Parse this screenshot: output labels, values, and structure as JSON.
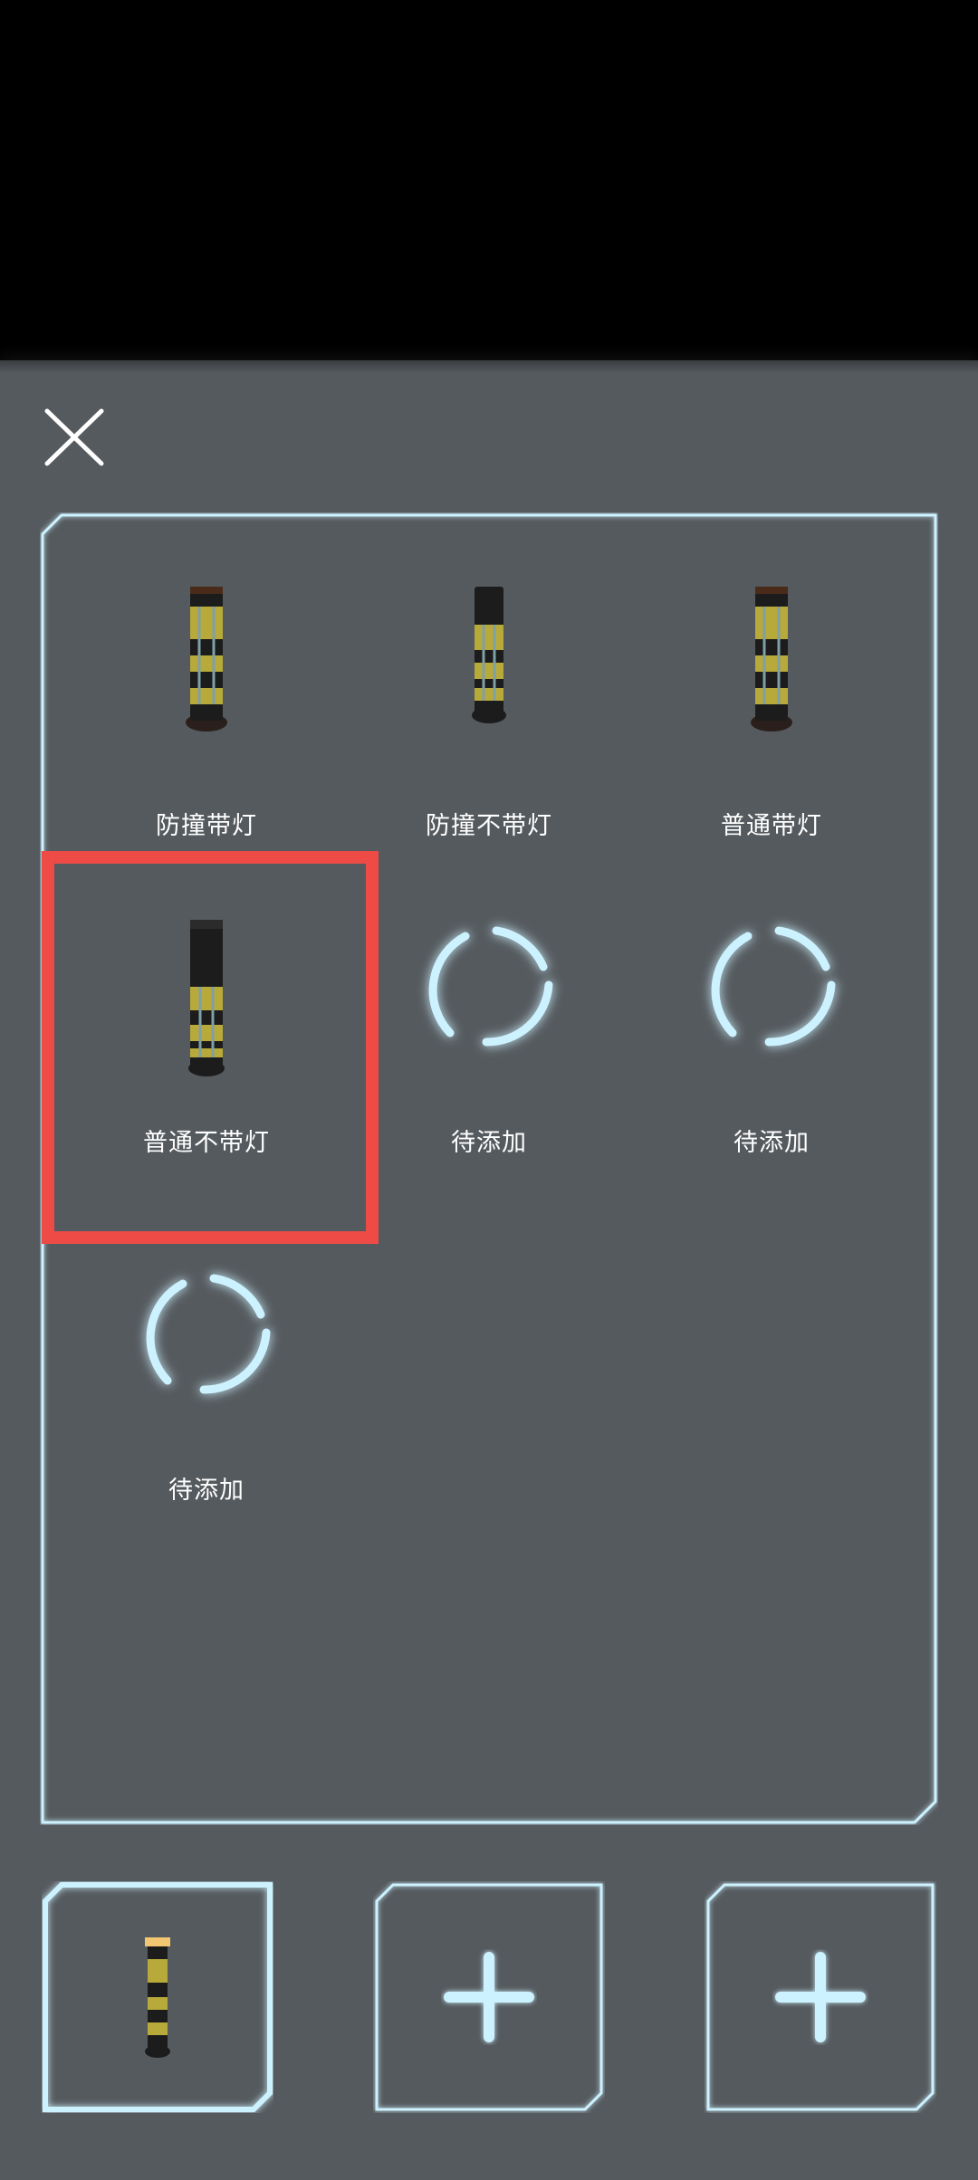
{
  "colors": {
    "sheet_bg": "#555a5e",
    "frame_glow": "#cdf2ff",
    "selection_border": "#ee4b47",
    "label_text": "#ffffff"
  },
  "close_icon": "close-icon",
  "grid": {
    "items": [
      {
        "label": "防撞带灯",
        "icon": "bollard-with-light-icon",
        "state": "filled"
      },
      {
        "label": "防撞不带灯",
        "icon": "bollard-no-light-icon",
        "state": "filled"
      },
      {
        "label": "普通带灯",
        "icon": "bollard-with-light-icon",
        "state": "filled"
      },
      {
        "label": "普通不带灯",
        "icon": "bollard-no-light-icon",
        "state": "selected"
      },
      {
        "label": "待添加",
        "icon": "loading-ring-icon",
        "state": "pending"
      },
      {
        "label": "待添加",
        "icon": "loading-ring-icon",
        "state": "pending"
      },
      {
        "label": "待添加",
        "icon": "loading-ring-icon",
        "state": "pending"
      }
    ]
  },
  "slots": [
    {
      "icon": "bollard-lit-icon",
      "state": "filled"
    },
    {
      "icon": "plus-icon",
      "state": "empty"
    },
    {
      "icon": "plus-icon",
      "state": "empty"
    }
  ]
}
